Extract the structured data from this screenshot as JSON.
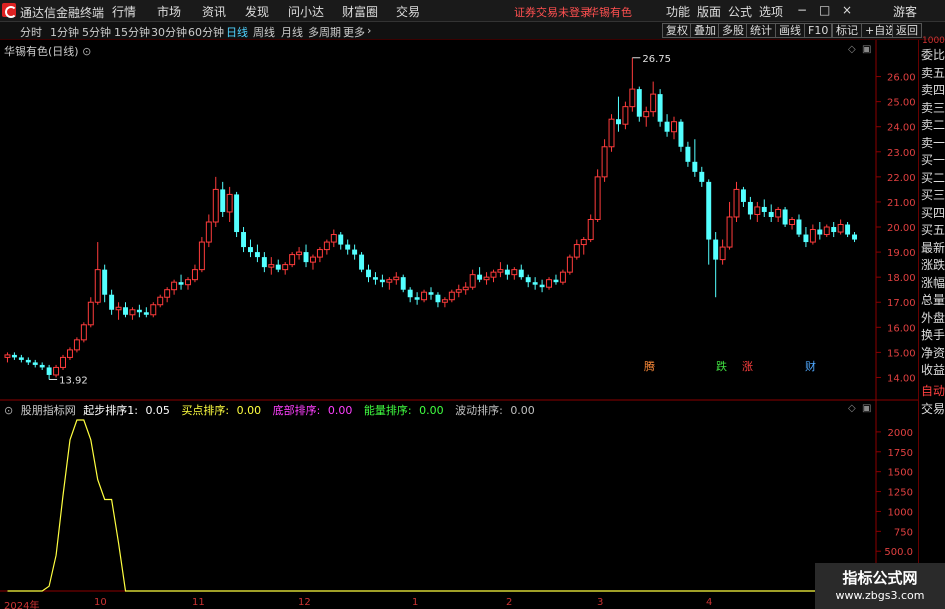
{
  "menubar": {
    "app_name": "通达信金融终端",
    "items": [
      "行情",
      "市场",
      "资讯",
      "发现",
      "问小达",
      "财富圈",
      "交易"
    ],
    "notice": "证券交易未登录",
    "stock_name": "华锡有色",
    "right_items": [
      "功能",
      "版面",
      "公式",
      "选项"
    ],
    "user": "游客"
  },
  "toolbar": {
    "timeframes": [
      "分时",
      "1分钟",
      "5分钟",
      "15分钟",
      "30分钟",
      "60分钟",
      "日线",
      "周线",
      "月线",
      "多周期",
      "更多"
    ],
    "active": "日线",
    "right_buttons": [
      "复权",
      "叠加",
      "多股",
      "统计",
      "画线",
      "F10",
      "标记",
      "+自选",
      "返回"
    ]
  },
  "chart": {
    "title": "华锡有色(日线)",
    "y_ticks": [
      "26.00",
      "25.00",
      "24.00",
      "23.00",
      "22.00",
      "21.00",
      "20.00",
      "19.00",
      "18.00",
      "17.00",
      "16.00",
      "15.00",
      "14.00"
    ],
    "top_tick": "1000",
    "high_label": "26.75",
    "low_label": "13.92",
    "event_markers": [
      {
        "text": "腾",
        "color": "#ff8c3a"
      },
      {
        "text": "跌",
        "color": "#40e040"
      },
      {
        "text": "涨",
        "color": "#ff4040"
      },
      {
        "text": "财",
        "color": "#4fa8ff"
      }
    ]
  },
  "chart_data": {
    "type": "candlestick",
    "title": "华锡有色(日线)",
    "ylim": [
      13.5,
      26.9
    ],
    "candles": [
      [
        14.8,
        15.0,
        14.6,
        14.9
      ],
      [
        14.9,
        15.0,
        14.7,
        14.8
      ],
      [
        14.8,
        14.9,
        14.6,
        14.7
      ],
      [
        14.7,
        14.8,
        14.5,
        14.6
      ],
      [
        14.6,
        14.7,
        14.4,
        14.5
      ],
      [
        14.5,
        14.6,
        14.3,
        14.4
      ],
      [
        14.4,
        14.5,
        13.92,
        14.1
      ],
      [
        14.1,
        14.5,
        14.0,
        14.4
      ],
      [
        14.4,
        14.9,
        14.3,
        14.8
      ],
      [
        14.8,
        15.2,
        14.7,
        15.1
      ],
      [
        15.1,
        15.6,
        15.0,
        15.5
      ],
      [
        15.5,
        16.2,
        15.4,
        16.1
      ],
      [
        16.1,
        17.2,
        16.0,
        17.0
      ],
      [
        17.0,
        19.4,
        16.9,
        18.3
      ],
      [
        18.3,
        18.5,
        17.0,
        17.3
      ],
      [
        17.3,
        17.5,
        16.5,
        16.7
      ],
      [
        16.7,
        17.0,
        16.3,
        16.8
      ],
      [
        16.8,
        17.0,
        16.4,
        16.5
      ],
      [
        16.5,
        16.8,
        16.3,
        16.7
      ],
      [
        16.7,
        16.9,
        16.4,
        16.6
      ],
      [
        16.6,
        16.8,
        16.4,
        16.5
      ],
      [
        16.5,
        17.0,
        16.4,
        16.9
      ],
      [
        16.9,
        17.3,
        16.8,
        17.2
      ],
      [
        17.2,
        17.6,
        17.0,
        17.5
      ],
      [
        17.5,
        17.9,
        17.3,
        17.8
      ],
      [
        17.8,
        18.1,
        17.5,
        17.7
      ],
      [
        17.7,
        18.0,
        17.5,
        17.9
      ],
      [
        17.9,
        18.5,
        17.8,
        18.3
      ],
      [
        18.3,
        19.6,
        18.2,
        19.4
      ],
      [
        19.4,
        20.5,
        19.2,
        20.2
      ],
      [
        20.2,
        22.0,
        20.0,
        21.5
      ],
      [
        21.5,
        21.8,
        20.4,
        20.6
      ],
      [
        20.6,
        21.6,
        20.2,
        21.3
      ],
      [
        21.3,
        21.4,
        19.6,
        19.8
      ],
      [
        19.8,
        20.0,
        19.0,
        19.2
      ],
      [
        19.2,
        19.5,
        18.8,
        19.0
      ],
      [
        19.0,
        19.3,
        18.6,
        18.8
      ],
      [
        18.8,
        19.0,
        18.2,
        18.4
      ],
      [
        18.4,
        18.8,
        18.1,
        18.5
      ],
      [
        18.5,
        18.7,
        18.2,
        18.3
      ],
      [
        18.3,
        18.6,
        18.1,
        18.5
      ],
      [
        18.5,
        19.0,
        18.4,
        18.9
      ],
      [
        18.9,
        19.2,
        18.7,
        19.0
      ],
      [
        19.0,
        19.3,
        18.4,
        18.6
      ],
      [
        18.6,
        18.9,
        18.3,
        18.8
      ],
      [
        18.8,
        19.2,
        18.6,
        19.1
      ],
      [
        19.1,
        19.5,
        18.9,
        19.4
      ],
      [
        19.4,
        19.9,
        19.2,
        19.7
      ],
      [
        19.7,
        19.8,
        19.1,
        19.3
      ],
      [
        19.3,
        19.5,
        18.9,
        19.1
      ],
      [
        19.1,
        19.3,
        18.7,
        18.9
      ],
      [
        18.9,
        19.0,
        18.2,
        18.3
      ],
      [
        18.3,
        18.5,
        17.8,
        18.0
      ],
      [
        18.0,
        18.2,
        17.7,
        17.9
      ],
      [
        17.9,
        18.1,
        17.6,
        17.8
      ],
      [
        17.8,
        18.0,
        17.5,
        17.9
      ],
      [
        17.9,
        18.2,
        17.7,
        18.0
      ],
      [
        18.0,
        18.1,
        17.4,
        17.5
      ],
      [
        17.5,
        17.6,
        17.0,
        17.2
      ],
      [
        17.2,
        17.4,
        16.9,
        17.1
      ],
      [
        17.1,
        17.5,
        17.0,
        17.4
      ],
      [
        17.4,
        17.6,
        17.1,
        17.3
      ],
      [
        17.3,
        17.4,
        16.8,
        17.0
      ],
      [
        17.0,
        17.2,
        16.8,
        17.1
      ],
      [
        17.1,
        17.5,
        17.0,
        17.4
      ],
      [
        17.4,
        17.7,
        17.2,
        17.5
      ],
      [
        17.5,
        17.8,
        17.3,
        17.6
      ],
      [
        17.6,
        18.3,
        17.5,
        18.1
      ],
      [
        18.1,
        18.4,
        17.8,
        17.9
      ],
      [
        17.9,
        18.2,
        17.7,
        18.0
      ],
      [
        18.0,
        18.3,
        17.8,
        18.2
      ],
      [
        18.2,
        18.6,
        18.0,
        18.3
      ],
      [
        18.3,
        18.5,
        17.9,
        18.1
      ],
      [
        18.1,
        18.4,
        17.9,
        18.3
      ],
      [
        18.3,
        18.5,
        17.9,
        18.0
      ],
      [
        18.0,
        18.1,
        17.6,
        17.8
      ],
      [
        17.8,
        18.0,
        17.5,
        17.7
      ],
      [
        17.7,
        17.9,
        17.4,
        17.6
      ],
      [
        17.6,
        18.0,
        17.5,
        17.9
      ],
      [
        17.9,
        18.1,
        17.7,
        17.8
      ],
      [
        17.8,
        18.3,
        17.7,
        18.2
      ],
      [
        18.2,
        18.9,
        18.1,
        18.8
      ],
      [
        18.8,
        19.5,
        18.7,
        19.3
      ],
      [
        19.3,
        19.6,
        18.9,
        19.5
      ],
      [
        19.5,
        20.5,
        19.4,
        20.3
      ],
      [
        20.3,
        22.3,
        20.2,
        22.0
      ],
      [
        22.0,
        23.5,
        21.8,
        23.2
      ],
      [
        23.2,
        24.5,
        23.0,
        24.3
      ],
      [
        24.3,
        25.2,
        23.8,
        24.1
      ],
      [
        24.1,
        25.0,
        23.9,
        24.8
      ],
      [
        24.8,
        26.75,
        24.6,
        25.5
      ],
      [
        25.5,
        25.6,
        24.2,
        24.4
      ],
      [
        24.4,
        24.8,
        24.0,
        24.6
      ],
      [
        24.6,
        25.8,
        24.4,
        25.3
      ],
      [
        25.3,
        25.5,
        24.0,
        24.2
      ],
      [
        24.2,
        24.5,
        23.6,
        23.8
      ],
      [
        23.8,
        24.4,
        23.5,
        24.2
      ],
      [
        24.2,
        24.3,
        23.0,
        23.2
      ],
      [
        23.2,
        23.4,
        22.4,
        22.6
      ],
      [
        22.6,
        23.5,
        22.0,
        22.2
      ],
      [
        22.2,
        22.4,
        21.6,
        21.8
      ],
      [
        21.8,
        21.9,
        18.5,
        19.5
      ],
      [
        19.5,
        19.8,
        17.2,
        18.7
      ],
      [
        18.7,
        19.5,
        18.5,
        19.2
      ],
      [
        19.2,
        21.0,
        19.1,
        20.4
      ],
      [
        20.4,
        21.8,
        20.2,
        21.5
      ],
      [
        21.5,
        21.6,
        20.8,
        21.0
      ],
      [
        21.0,
        21.2,
        20.3,
        20.5
      ],
      [
        20.5,
        21.0,
        20.2,
        20.8
      ],
      [
        20.8,
        21.1,
        20.4,
        20.6
      ],
      [
        20.6,
        20.9,
        20.2,
        20.4
      ],
      [
        20.4,
        20.8,
        20.2,
        20.7
      ],
      [
        20.7,
        20.8,
        20.0,
        20.1
      ],
      [
        20.1,
        20.4,
        19.9,
        20.3
      ],
      [
        20.3,
        20.5,
        19.6,
        19.7
      ],
      [
        19.7,
        20.0,
        19.2,
        19.4
      ],
      [
        19.4,
        20.1,
        19.3,
        19.9
      ],
      [
        19.9,
        20.2,
        19.5,
        19.7
      ],
      [
        19.7,
        20.1,
        19.6,
        20.0
      ],
      [
        20.0,
        20.2,
        19.6,
        19.8
      ],
      [
        19.8,
        20.3,
        19.7,
        20.1
      ],
      [
        20.1,
        20.2,
        19.6,
        19.7
      ],
      [
        19.7,
        19.8,
        19.4,
        19.5
      ]
    ]
  },
  "indicator": {
    "name": "股朋指标网",
    "items": [
      {
        "label": "起步排序1:",
        "value": "0.05",
        "color": "#ffffff"
      },
      {
        "label": "买点排序:",
        "value": "0.00",
        "color": "#ffff40"
      },
      {
        "label": "底部排序:",
        "value": "0.00",
        "color": "#ff40ff"
      },
      {
        "label": "能量排序:",
        "value": "0.00",
        "color": "#40ff40"
      },
      {
        "label": "波动排序:",
        "value": "0.00",
        "color": "#c0c0c0"
      }
    ],
    "y_ticks": [
      "2000",
      "1750",
      "1500",
      "1250",
      "1000",
      "750",
      "500.0"
    ],
    "series": [
      0,
      0,
      0,
      0,
      0,
      0,
      60,
      450,
      1200,
      1900,
      2150,
      2150,
      1900,
      1400,
      1150,
      1150,
      600,
      0,
      0,
      0,
      0,
      0,
      0,
      0,
      0,
      0,
      0,
      0,
      0,
      0,
      0,
      0,
      0,
      0,
      0,
      0,
      0,
      0,
      0,
      0,
      0,
      0,
      0,
      0,
      0,
      0,
      0,
      0,
      0,
      0,
      0,
      0,
      0,
      0,
      0,
      0,
      0,
      0,
      0,
      0,
      0,
      0,
      0,
      0,
      0,
      0,
      0,
      0,
      0,
      0,
      0,
      0,
      0,
      0,
      0,
      0,
      0,
      0,
      0,
      0,
      0,
      0,
      0,
      0,
      0,
      0,
      0,
      0,
      0,
      0,
      0,
      0,
      0,
      0,
      0,
      0,
      0,
      0,
      0,
      0,
      0,
      0,
      0,
      0,
      0,
      0,
      0,
      0,
      0,
      0,
      0,
      0,
      0,
      0,
      0,
      0,
      0,
      0,
      0,
      0,
      0,
      0,
      0,
      0,
      0
    ]
  },
  "dates": [
    "2024年",
    "10",
    "11",
    "12",
    "1",
    "2",
    "3",
    "4"
  ],
  "sidebar": {
    "items": [
      "委比",
      "卖五",
      "卖四",
      "卖三",
      "卖二",
      "卖一",
      "买一",
      "买二",
      "买三",
      "买四",
      "买五",
      "最新",
      "涨跌",
      "涨幅",
      "总量",
      "外盘",
      "换手",
      "净资",
      "收益"
    ],
    "auto": "自动",
    "trade": "交易"
  },
  "watermark": {
    "line1": "指标公式网",
    "line2": "www.zbgs3.com"
  }
}
